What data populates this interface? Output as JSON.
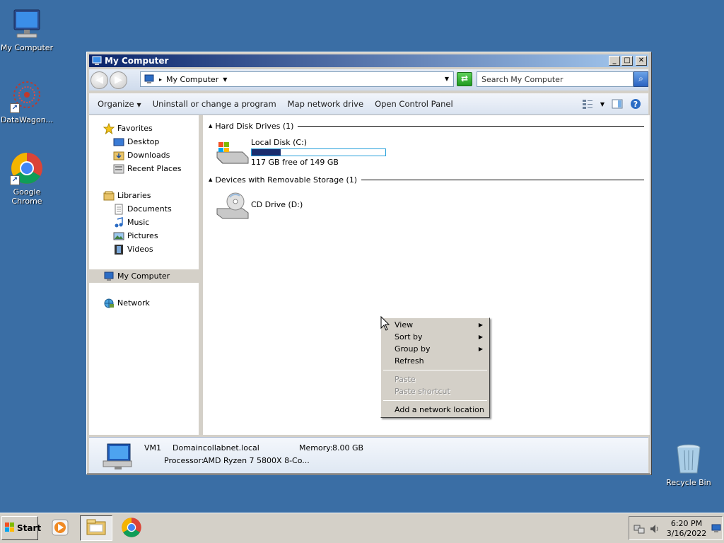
{
  "desktop": {
    "icons": [
      {
        "label": "My Computer",
        "icon": "computer-icon"
      },
      {
        "label": "DataWagon...",
        "icon": "datawagon-icon"
      },
      {
        "label": "Google Chrome",
        "icon": "chrome-icon"
      },
      {
        "label": "Recycle Bin",
        "icon": "recycle-bin-icon"
      }
    ]
  },
  "window": {
    "title": "My Computer",
    "buttons": {
      "minimize": "_",
      "maximize": "□",
      "close": "✕"
    },
    "address": {
      "location": "My Computer",
      "separator": "▸"
    },
    "search": {
      "placeholder": "Search My Computer"
    },
    "commands": [
      {
        "label": "Organize",
        "caret": "▼"
      },
      {
        "label": "Uninstall or change a program"
      },
      {
        "label": "Map network drive"
      },
      {
        "label": "Open Control Panel"
      }
    ],
    "nav": {
      "favorites": {
        "label": "Favorites",
        "items": [
          "Desktop",
          "Downloads",
          "Recent Places"
        ]
      },
      "libraries": {
        "label": "Libraries",
        "items": [
          "Documents",
          "Music",
          "Pictures",
          "Videos"
        ]
      },
      "computer": {
        "label": "My Computer"
      },
      "network": {
        "label": "Network"
      }
    },
    "content": {
      "groups": [
        {
          "label": "Hard Disk Drives (1)"
        },
        {
          "label": "Devices with Removable Storage (1)"
        }
      ],
      "drives": [
        {
          "name": "Local Disk (C:)",
          "free": "117 GB free of 149 GB",
          "used_fraction": 0.215
        },
        {
          "name": "CD Drive (D:)"
        }
      ]
    },
    "details": {
      "name": "VM1",
      "domain_label": "Domain:",
      "domain": "collabnet.local",
      "memory_label": "Memory:",
      "memory": "8.00 GB",
      "processor_label": "Processor:",
      "processor": "AMD Ryzen 7 5800X 8-Co..."
    }
  },
  "context_menu": {
    "items": [
      {
        "label": "View",
        "submenu": true,
        "disabled": false
      },
      {
        "label": "Sort by",
        "submenu": true,
        "disabled": false
      },
      {
        "label": "Group by",
        "submenu": true,
        "disabled": false
      },
      {
        "label": "Refresh",
        "submenu": false,
        "disabled": false
      },
      {
        "label": "Paste",
        "submenu": false,
        "disabled": true
      },
      {
        "label": "Paste shortcut",
        "submenu": false,
        "disabled": true
      },
      {
        "label": "Add a network location",
        "submenu": false,
        "disabled": false
      }
    ],
    "submenu_arrow": "▶"
  },
  "taskbar": {
    "start_label": "Start",
    "time": "6:20 PM",
    "date": "3/16/2022"
  },
  "colors": {
    "desktop": "#3a6ea5",
    "title_start": "#0a246a",
    "title_end": "#a6caf0",
    "usage_fill": "#1b2d6e"
  }
}
